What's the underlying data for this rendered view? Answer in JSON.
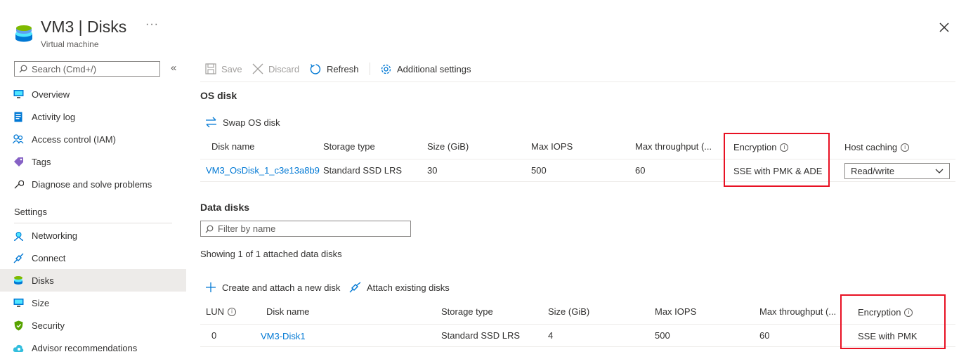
{
  "header": {
    "title": "VM3 | Disks",
    "subtitle": "Virtual machine",
    "more": "···"
  },
  "sidebar": {
    "search_placeholder": "Search (Cmd+/)",
    "collapse": "«",
    "items": [
      {
        "label": "Overview",
        "icon": "monitor-icon"
      },
      {
        "label": "Activity log",
        "icon": "log-icon"
      },
      {
        "label": "Access control (IAM)",
        "icon": "people-icon"
      },
      {
        "label": "Tags",
        "icon": "tag-icon"
      },
      {
        "label": "Diagnose and solve problems",
        "icon": "wrench-icon"
      }
    ],
    "settings_label": "Settings",
    "settings_items": [
      {
        "label": "Networking",
        "icon": "network-icon"
      },
      {
        "label": "Connect",
        "icon": "plug-icon"
      },
      {
        "label": "Disks",
        "icon": "disks-icon",
        "active": true
      },
      {
        "label": "Size",
        "icon": "size-monitor-icon"
      },
      {
        "label": "Security",
        "icon": "shield-icon"
      },
      {
        "label": "Advisor recommendations",
        "icon": "cloud-advisor-icon"
      }
    ]
  },
  "toolbar": {
    "save": "Save",
    "discard": "Discard",
    "refresh": "Refresh",
    "additional": "Additional settings"
  },
  "os_disk": {
    "heading": "OS disk",
    "swap": "Swap OS disk",
    "columns": [
      "Disk name",
      "Storage type",
      "Size (GiB)",
      "Max IOPS",
      "Max throughput (...",
      "Encryption",
      "Host caching"
    ],
    "row": {
      "name": "VM3_OsDisk_1_c3e13a8b9",
      "storage": "Standard SSD LRS",
      "size": "30",
      "iops": "500",
      "throughput": "60",
      "encryption": "SSE with PMK & ADE",
      "caching": "Read/write"
    }
  },
  "data_disks": {
    "heading": "Data disks",
    "filter_placeholder": "Filter by name",
    "showing": "Showing 1 of 1 attached data disks",
    "create": "Create and attach a new disk",
    "attach": "Attach existing disks",
    "columns": [
      "LUN",
      "Disk name",
      "Storage type",
      "Size (GiB)",
      "Max IOPS",
      "Max throughput (...",
      "Encryption"
    ],
    "row": {
      "lun": "0",
      "name": "VM3-Disk1",
      "storage": "Standard SSD LRS",
      "size": "4",
      "iops": "500",
      "throughput": "60",
      "encryption": "SSE with PMK"
    }
  },
  "colors": {
    "accent": "#0078d4",
    "highlight_box": "#e81123",
    "active_nav": "#edebe9"
  }
}
